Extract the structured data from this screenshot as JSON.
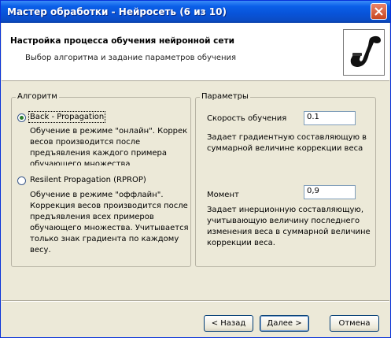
{
  "window": {
    "title": "Мастер обработки - Нейросеть (6 из 10)"
  },
  "header": {
    "title": "Настройка процесса обучения нейронной сети",
    "subtitle": "Выбор алгоритма и задание параметров обучения"
  },
  "algorithm": {
    "legend": "Алгоритм",
    "options": [
      {
        "label": "Back - Propagation",
        "selected": true,
        "description": [
          "Обучение в режиме \"онлайн\". Коррекция",
          "весов производится после",
          "предъявления каждого примера",
          "обучающего множества"
        ]
      },
      {
        "label": "Resilent Propagation (RPROP)",
        "selected": false,
        "description": [
          "Обучение в режиме \"оффлайн\".",
          "Коррекция весов производится после",
          "предъявления всех примеров",
          "обучающего множества. Учитывается",
          "только знак градиента по каждому",
          "весу."
        ]
      }
    ]
  },
  "params": {
    "legend": "Параметры",
    "learning_rate": {
      "label": "Скорость обучения",
      "value": "0.1",
      "description": [
        "Задает градиентную составляющую в",
        "суммарной величине коррекции веса"
      ]
    },
    "momentum": {
      "label": "Момент",
      "value": "0,9",
      "description": [
        "Задает инерционную составляющую,",
        "учитывающую величину последнего",
        "изменения веса в суммарной величине",
        "коррекции веса."
      ]
    }
  },
  "buttons": {
    "back": "< Назад",
    "next": "Далее >",
    "cancel": "Отмена"
  },
  "icons": {
    "close": "close-icon",
    "logo": "pipe-icon"
  }
}
